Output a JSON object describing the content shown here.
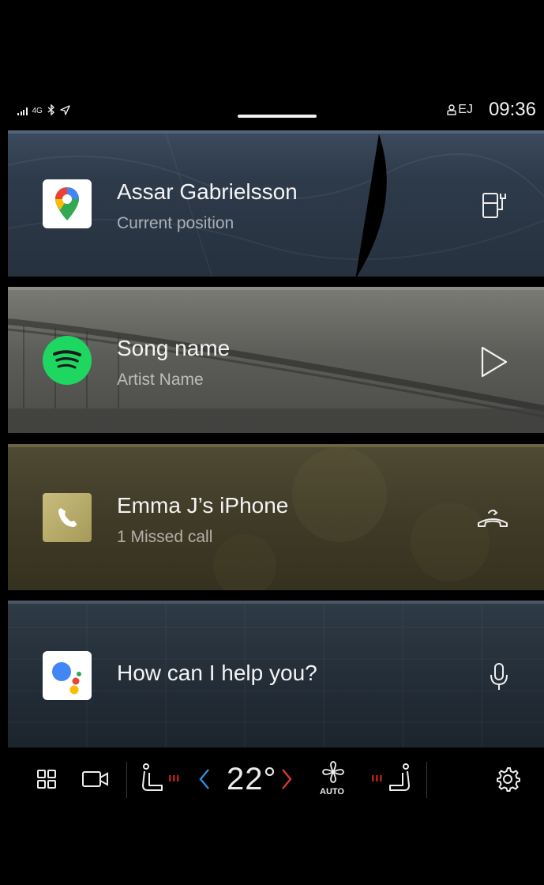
{
  "status_bar": {
    "network": "4G",
    "profile": "EJ",
    "time": "09:36"
  },
  "tiles": [
    {
      "id": "maps",
      "app_icon": "google-maps-icon",
      "title": "Assar Gabrielsson",
      "subtitle": "Current position",
      "action_icon": "fuel-station-icon"
    },
    {
      "id": "music",
      "app_icon": "spotify-icon",
      "title": "Song name",
      "subtitle": "Artist Name",
      "action_icon": "play-icon"
    },
    {
      "id": "phone",
      "app_icon": "phone-icon",
      "title": "Emma J’s iPhone",
      "subtitle": "1 Missed call",
      "action_icon": "call-back-icon"
    },
    {
      "id": "assistant",
      "app_icon": "google-assistant-icon",
      "title": "How can I help you?",
      "action_icon": "microphone-icon"
    }
  ],
  "climate": {
    "temperature": "22°",
    "fan_mode": "AUTO",
    "left_arrow_color": "#2b8fd6",
    "right_arrow_color": "#d63a2f",
    "seat_heat_color": "#b3221a"
  },
  "colors": {
    "background": "#000000",
    "spotify_green": "#1ed760",
    "phone_gold": "#b7ab6b"
  }
}
